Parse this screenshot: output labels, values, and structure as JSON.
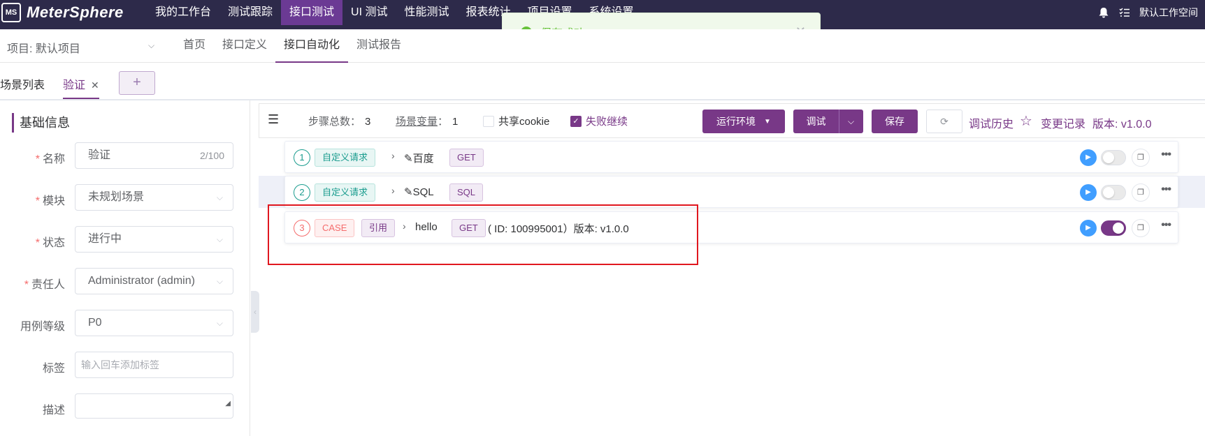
{
  "topbar": {
    "logo_mark": "MS",
    "logo_text": "MeterSphere",
    "nav": [
      "我的工作台",
      "测试跟踪",
      "接口测试",
      "UI 测试",
      "性能测试",
      "报表统计",
      "项目设置",
      "系统设置"
    ],
    "active_nav": "接口测试",
    "workspace": "默认工作空间"
  },
  "toast": {
    "message": "保存成功"
  },
  "subbar": {
    "project": "项目: 默认项目",
    "nav": [
      "首页",
      "接口定义",
      "接口自动化",
      "测试报告"
    ],
    "active_nav": "接口自动化"
  },
  "tabs": {
    "scene_list": "场景列表",
    "current": "验证",
    "add": "+"
  },
  "basic_info": {
    "title": "基础信息",
    "fields": {
      "name": {
        "label": "名称",
        "value": "验证",
        "count": "2/100"
      },
      "module": {
        "label": "模块",
        "value": "未规划场景"
      },
      "status": {
        "label": "状态",
        "value": "进行中"
      },
      "owner": {
        "label": "责任人",
        "value": "Administrator (admin)"
      },
      "level": {
        "label": "用例等级",
        "value": "P0"
      },
      "tags": {
        "label": "标签",
        "placeholder": "输入回车添加标签"
      },
      "desc": {
        "label": "描述",
        "value": ""
      }
    }
  },
  "toolbar": {
    "steps_label": "步骤总数：",
    "steps_value": "3",
    "vars_label": "场景变量",
    "vars_sep": "：",
    "vars_value": "1",
    "share_cookie": "共享cookie",
    "continue_on_fail": "失败继续",
    "env_button": "运行环境",
    "debug_button": "调试",
    "save_button": "保存",
    "history": "调试历史",
    "changelog": "变更记录",
    "version": "版本: v1.0.0"
  },
  "steps": [
    {
      "index": "1",
      "type": "自定义请求",
      "name": "百度",
      "method": "GET",
      "enabled": false
    },
    {
      "index": "2",
      "type": "自定义请求",
      "name": "SQL",
      "method": "SQL",
      "enabled": false
    },
    {
      "index": "3",
      "type": "CASE",
      "ref": "引用",
      "name": "hello",
      "method": "GET",
      "detail": "( ID: 100995001）版本: v1.0.0",
      "enabled": true
    }
  ],
  "colors": {
    "brand": "#783887",
    "nav_bg": "#2d2a4a",
    "success": "#67c23a",
    "highlight": "#e0171f"
  }
}
